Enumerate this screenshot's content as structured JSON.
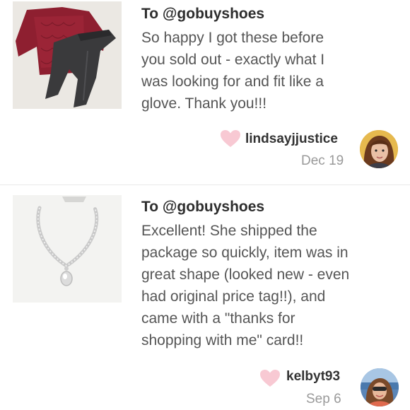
{
  "reviews": [
    {
      "to": "To @gobuyshoes",
      "body_lines": [
        "So happy I got these before",
        "you sold out - exactly what I",
        "was looking for and fit like a",
        "glove. Thank you!!!"
      ],
      "username": "lindsayjjustice",
      "date": "Dec 19",
      "item_image": "red-sweater-and-black-jeans",
      "avatar_image": "user-avatar"
    },
    {
      "to": "To @gobuyshoes",
      "body_lines": [
        "Excellent! She shipped the",
        "package so quickly, item was in",
        "great shape (looked new - even",
        "had original price tag!!), and",
        "came with a \"thanks for",
        "shopping with me\" card!!"
      ],
      "username": "kelbyt93",
      "date": "Sep 6",
      "item_image": "crystal-necklace",
      "avatar_image": "user-avatar"
    }
  ],
  "colors": {
    "heart": "#f8c9d3",
    "text": "#555555",
    "heading": "#2d2d2d",
    "date": "#9a9a9a",
    "divider": "#e9e9e9"
  }
}
